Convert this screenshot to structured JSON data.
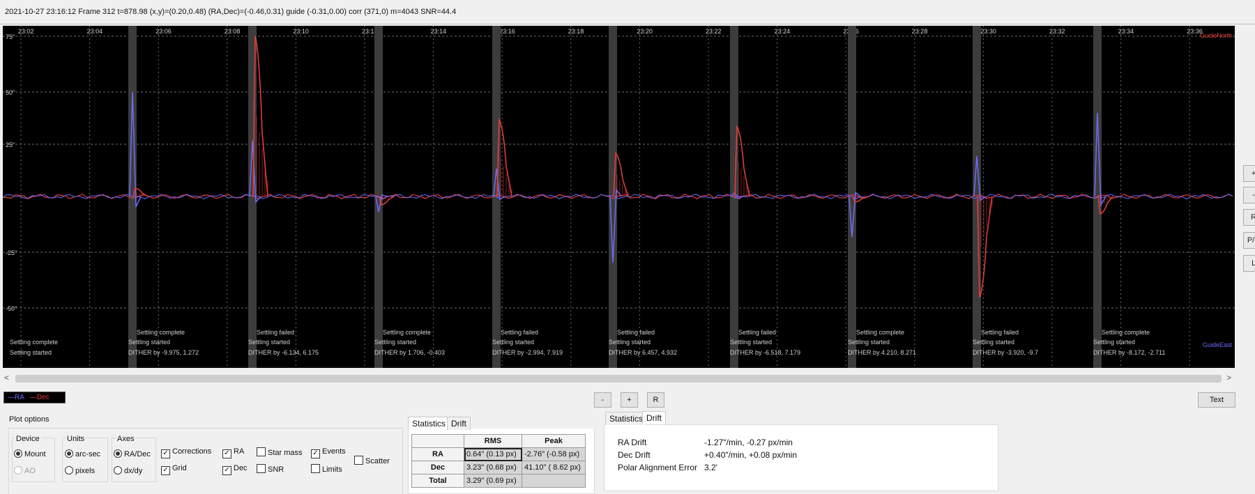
{
  "status": {
    "text": "2021-10-27 23:16:12 Frame 312 t=878.98 (x,y)=(0.20,0.48) (RA,Dec)=(-0.46,0.31) guide (-0.31,0.00) corr (371,0) m=4043 SNR=44.4"
  },
  "graph": {
    "time_labels": [
      "23:02",
      "23:04",
      "23:06",
      "23:08",
      "23:10",
      "23:12",
      "23:14",
      "23:16",
      "23:18",
      "23:20",
      "23:22",
      "23:24",
      "23:26",
      "23:28",
      "23:30",
      "23:32",
      "23:34",
      "23:36"
    ],
    "y_labels": [
      "75\"",
      "50\"",
      "25\"",
      "",
      "-25\"",
      "-50\""
    ],
    "top_right_label": "GuideNorth",
    "bottom_right_label": "GuideEast",
    "colors": {
      "ra": "#6b6bff",
      "dec": "#e43c3c",
      "band": "#3c3c3c",
      "grid": "#6e6e6e",
      "text": "#cfcfcf"
    },
    "events": [
      {
        "upper": "",
        "mid": "Settling complete",
        "low": "Settling started"
      },
      {
        "upper": "Settling complete",
        "mid": "Settling started",
        "low": "DITHER by -9.975, 1.272"
      },
      {
        "upper": "Settling failed",
        "mid": "Settling started",
        "low": "DITHER by -6.134, 6.175"
      },
      {
        "upper": "Settling complete",
        "mid": "Settling started",
        "low": "DITHER by 1.706, -0.403"
      },
      {
        "upper": "Settling failed",
        "mid": "Settling started",
        "low": "DITHER by -2.994, 7.919"
      },
      {
        "upper": "Settling failed",
        "mid": "Settling started",
        "low": "DITHER by 6.457, 4.932"
      },
      {
        "upper": "Settling failed",
        "mid": "Settling started",
        "low": "DITHER by -6.518, 7.179"
      },
      {
        "upper": "Settling complete",
        "mid": "Settling started",
        "low": "DITHER by 4.210, 8.271"
      },
      {
        "upper": "Settling failed",
        "mid": "Settling started",
        "low": "DITHER by -3.920, -9.7"
      },
      {
        "upper": "Settling complete",
        "mid": "Settling started",
        "low": "DITHER by -8.172, -2.711"
      }
    ]
  },
  "right_buttons": [
    "+",
    "-",
    "R",
    "P/C",
    "L"
  ],
  "legend": {
    "ra": "RA",
    "dec": "Dec"
  },
  "zoom_buttons": {
    "minus": "-",
    "plus": "+",
    "reset": "R"
  },
  "text_button": "Text",
  "plot_options": {
    "title": "Plot options",
    "device": {
      "label": "Device",
      "mount": "Mount",
      "ao": "AO"
    },
    "units": {
      "label": "Units",
      "arcsec": "arc-sec",
      "pixels": "pixels"
    },
    "axes": {
      "label": "Axes",
      "radec": "RA/Dec",
      "dxdy": "dx/dy"
    },
    "checks": {
      "corrections": "Corrections",
      "grid": "Grid",
      "ra": "RA",
      "dec": "Dec",
      "star_mass": "Star mass",
      "snr": "SNR",
      "events": "Events",
      "limits": "Limits",
      "scatter": "Scatter"
    }
  },
  "stats_tabs": {
    "statistics": "Statistics",
    "drift": "Drift"
  },
  "stats_table": {
    "headers": [
      "RMS",
      "Peak"
    ],
    "rows": [
      {
        "label": "RA",
        "rms": "0.64\" (0.13 px)",
        "peak": "-2.76\" (-0.58 px)"
      },
      {
        "label": "Dec",
        "rms": "3.23\" (0.68 px)",
        "peak": "41.10\" ( 8.62 px)"
      },
      {
        "label": "Total",
        "rms": "3.29\" (0.69 px)",
        "peak": ""
      }
    ]
  },
  "drift_tabs": {
    "statistics": "Statistics",
    "drift": "Drift"
  },
  "drift": {
    "ra_label": "RA Drift",
    "ra_value": "-1.27\"/min, -0.27 px/min",
    "dec_label": "Dec Drift",
    "dec_value": "+0.40\"/min, +0.08 px/min",
    "pae_label": "Polar Alignment Error",
    "pae_value": "3.2'"
  }
}
